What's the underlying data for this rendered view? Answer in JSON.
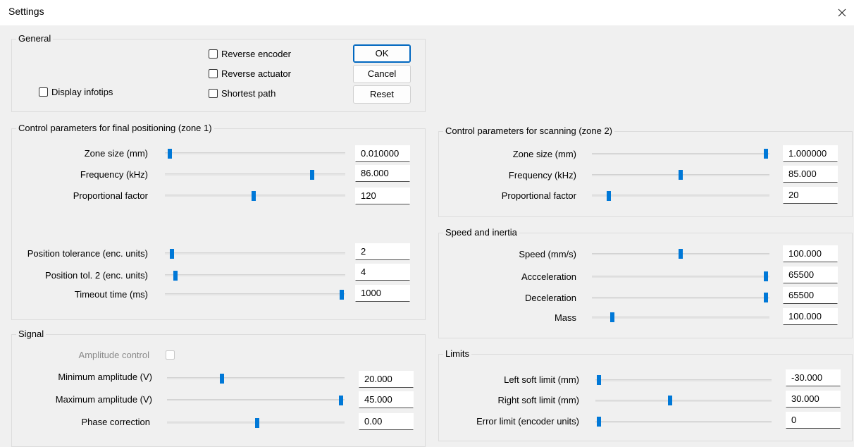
{
  "window": {
    "title": "Settings",
    "close_label": "Close"
  },
  "general": {
    "title": "General",
    "checkboxes": {
      "reverse_encoder": {
        "label": "Reverse encoder",
        "checked": false
      },
      "reverse_actuator": {
        "label": "Reverse actuator",
        "checked": false
      },
      "shortest_path": {
        "label": "Shortest path",
        "checked": false
      },
      "display_infotips": {
        "label": "Display infotips",
        "checked": false
      }
    },
    "buttons": {
      "ok": "OK",
      "cancel": "Cancel",
      "reset": "Reset"
    }
  },
  "zone1": {
    "title": "Control parameters for final positioning (zone 1)",
    "rows": [
      {
        "label": "Zone size (mm)",
        "value": "0.010000",
        "level": 0.01
      },
      {
        "label": "Frequency (kHz)",
        "value": "86.000",
        "level": 0.83
      },
      {
        "label": "Proportional factor",
        "value": "120",
        "level": 0.49
      },
      {
        "label": "Position tolerance (enc. units)",
        "value": "2",
        "level": 0.02
      },
      {
        "label": "Position tol. 2 (enc. units)",
        "value": "4",
        "level": 0.04
      },
      {
        "label": "Timeout time (ms)",
        "value": "1000",
        "level": 1.0
      }
    ]
  },
  "signal": {
    "title": "Signal",
    "amplitude_control": {
      "label": "Amplitude control",
      "checked": false,
      "enabled": false
    },
    "rows": [
      {
        "label": "Minimum amplitude (V)",
        "value": "20.000",
        "level": 0.3
      },
      {
        "label": "Maximum amplitude (V)",
        "value": "45.000",
        "level": 1.0
      },
      {
        "label": "Phase correction",
        "value": "0.00",
        "level": 0.51
      }
    ]
  },
  "zone2": {
    "title": "Control parameters for scanning (zone 2)",
    "rows": [
      {
        "label": "Zone size (mm)",
        "value": "1.000000",
        "level": 1.0
      },
      {
        "label": "Frequency (kHz)",
        "value": "85.000",
        "level": 0.5
      },
      {
        "label": "Proportional factor",
        "value": "20",
        "level": 0.08
      }
    ]
  },
  "speed": {
    "title": "Speed and inertia",
    "rows": [
      {
        "label": "Speed (mm/s)",
        "value": "100.000",
        "level": 0.5
      },
      {
        "label": "Accceleration",
        "value": "65500",
        "level": 1.0
      },
      {
        "label": "Deceleration",
        "value": "65500",
        "level": 1.0
      },
      {
        "label": "Mass",
        "value": "100.000",
        "level": 0.1
      }
    ]
  },
  "limits": {
    "title": "Limits",
    "rows": [
      {
        "label": "Left soft limit (mm)",
        "value": "-30.000",
        "level": 0.0
      },
      {
        "label": "Right soft limit (mm)",
        "value": "30.000",
        "level": 0.42
      },
      {
        "label": "Error limit (encoder units)",
        "value": "0",
        "level": 0.0
      }
    ]
  },
  "colors": {
    "accent": "#0078d7",
    "background": "#f0f0f0",
    "titlebar": "#ffffff"
  }
}
